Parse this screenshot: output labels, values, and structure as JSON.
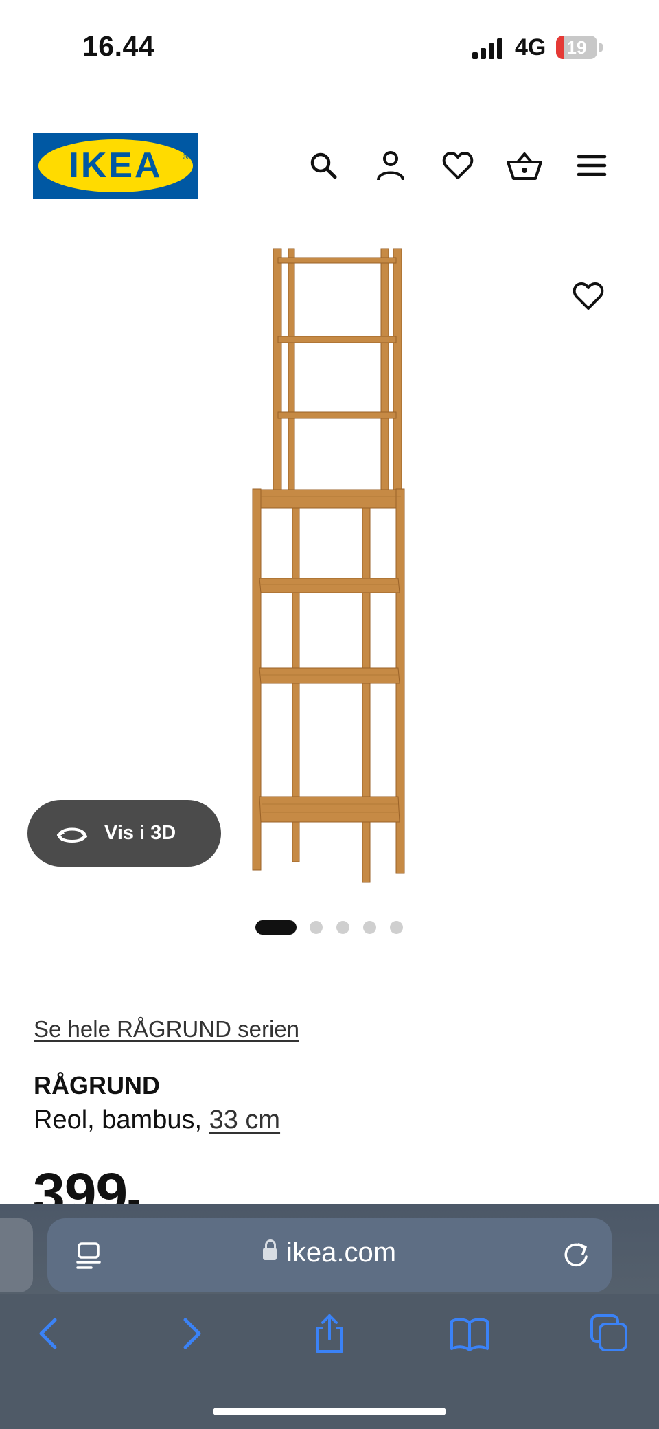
{
  "status_bar": {
    "time": "16.44",
    "network": "4G",
    "battery_level": "19"
  },
  "header": {
    "logo_text": "IKEA",
    "icons": [
      "search-icon",
      "account-icon",
      "heart-icon",
      "basket-icon",
      "menu-icon"
    ]
  },
  "gallery": {
    "view_3d_label": "Vis i 3D",
    "image_count": 5,
    "active_index": 0
  },
  "product": {
    "series_link": "Se hele RÅGRUND serien",
    "name": "RÅGRUND",
    "description": "Reol, bambus,",
    "size_link": "33 cm",
    "price": "399",
    "price_suffix": "-"
  },
  "browser": {
    "url": "ikea.com",
    "toolbar": [
      "back-icon",
      "forward-icon",
      "share-icon",
      "bookmarks-icon",
      "tabs-icon"
    ]
  },
  "colors": {
    "ikea_blue": "#0058a3",
    "ikea_yellow": "#ffdb00",
    "toolbar_accent": "#3b82f6",
    "pill_bg": "#4b4b4b",
    "wood": "#c68a45"
  }
}
